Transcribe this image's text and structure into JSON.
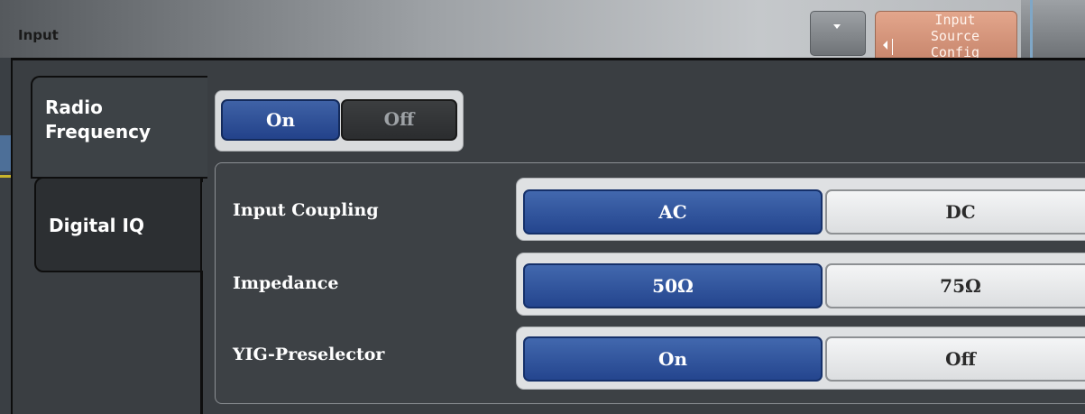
{
  "window": {
    "title": "Input"
  },
  "softkey": {
    "label": "Input\nSource\nConfig"
  },
  "tabs": [
    {
      "label": "Radio\nFrequency",
      "active": true
    },
    {
      "label": "Digital IQ",
      "active": false
    }
  ],
  "rf_toggle": {
    "on_label": "On",
    "off_label": "Off",
    "selected": "On"
  },
  "settings": [
    {
      "label": "Input Coupling",
      "options": [
        "AC",
        "DC"
      ],
      "selected": "AC"
    },
    {
      "label": "Impedance",
      "options": [
        "50Ω",
        "75Ω"
      ],
      "selected": "50Ω"
    },
    {
      "label": "YIG-Preselector",
      "options": [
        "On",
        "Off"
      ],
      "selected": "On"
    }
  ],
  "colors": {
    "accent_blue": "#2a4a92",
    "softkey_orange": "#d4937a",
    "panel_bg": "#3a3e42"
  },
  "icons": {
    "dropdown": "chevron-down-icon",
    "softkey_arrow": "arrow-left-icon"
  }
}
